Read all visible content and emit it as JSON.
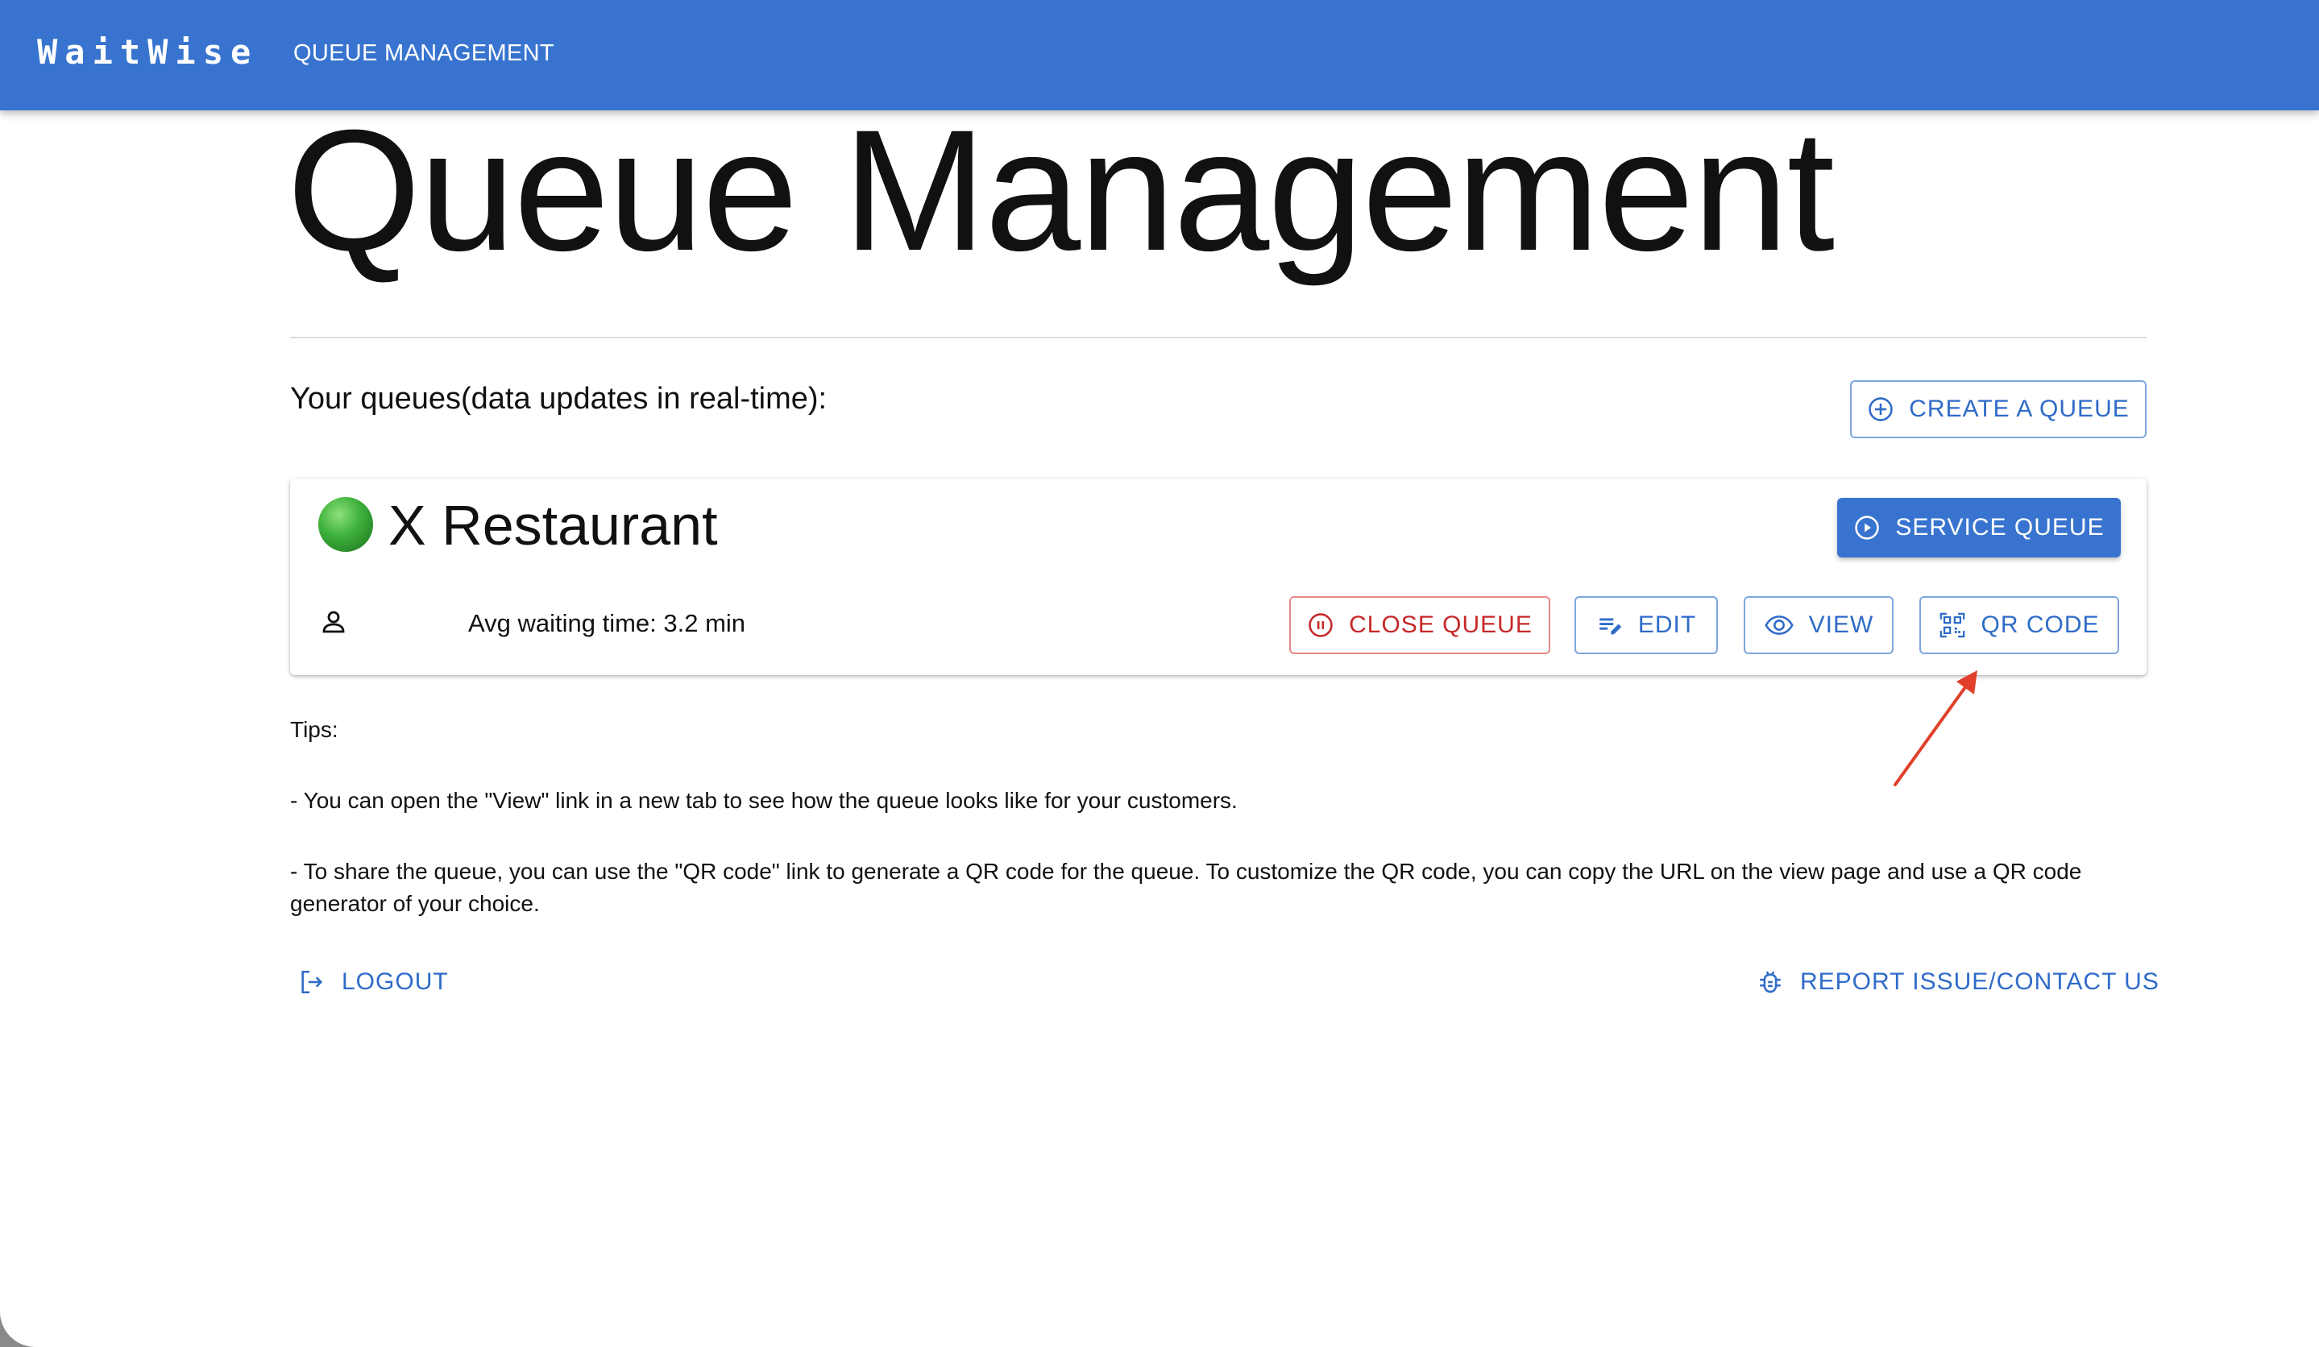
{
  "appbar": {
    "brand": "WaitWise",
    "nav_link": "QUEUE MANAGEMENT",
    "color": "#3874cf"
  },
  "page": {
    "title": "Queue Management",
    "section_heading": "Your queues(data updates in real-time):"
  },
  "create_button": {
    "label": "CREATE A QUEUE",
    "icon": "add-circle-icon"
  },
  "queue_card": {
    "status_icon": "green-circle",
    "status_color": "#3aa93f",
    "name": "X Restaurant",
    "service_button": {
      "label": "SERVICE QUEUE",
      "icon": "play-circle-icon"
    },
    "person_icon": "person-icon",
    "avg_wait": "Avg waiting time: 3.2 min",
    "actions": {
      "close": {
        "label": "CLOSE QUEUE",
        "icon": "pause-circle-icon",
        "color": "#c62828"
      },
      "edit": {
        "label": "EDIT",
        "icon": "edit-note-icon"
      },
      "view": {
        "label": "VIEW",
        "icon": "eye-icon"
      },
      "qr": {
        "label": "QR CODE",
        "icon": "qr-code-icon"
      }
    }
  },
  "tips": {
    "title": "Tips:",
    "items": [
      "- You can open the \"View\" link in a new tab to see how the queue looks like for your customers.",
      "- To share the queue, you can use the \"QR code\" link to generate a QR code for the queue. To customize the QR code, you can copy the URL on the view page and use a QR code generator of your choice."
    ]
  },
  "footer": {
    "logout": {
      "label": "LOGOUT",
      "icon": "logout-icon"
    },
    "report": {
      "label": "REPORT ISSUE/CONTACT US",
      "icon": "bug-icon"
    }
  },
  "annotation": {
    "arrow_color": "#e0402a",
    "points_to": "qr-code-button"
  }
}
